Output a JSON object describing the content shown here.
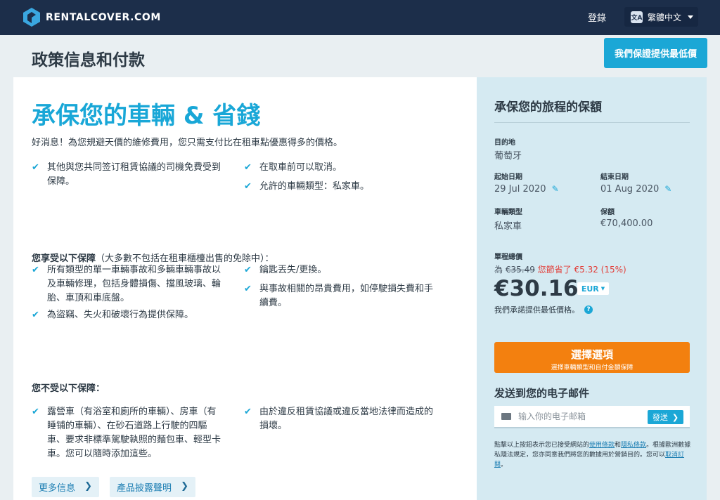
{
  "header": {
    "logo_text": "RENTALCOVER.COM",
    "login": "登錄",
    "language": "繁體中文",
    "lang_icon": "文A"
  },
  "page": {
    "title": "政策信息和付款",
    "price_button": "我們保證提供最低價"
  },
  "main": {
    "headline": "承保您的車輛 & 省錢",
    "intro": "好消息！為您規避天價的維修費用，您只需支付比在租車點優惠得多的價格。",
    "checks_top": [
      {
        "line1": "其他與您共同签订租賃協議的司機免費受到",
        "line2": "保障。"
      },
      {
        "line1": "在取車前可以取消。"
      },
      {
        "line1": "允許的車輛類型：私家車。"
      }
    ],
    "covered_bold": "您享受以下保障",
    "covered_rest": "（大多數不包括在租車櫃檯出售的免除中）：",
    "covered": [
      {
        "lines": [
          "所有類型的單一車輛事故和多輛車輛事故以",
          "及車輛修理，包括身體損傷、擋風玻璃、輪",
          "胎、車頂和車底盤。"
        ]
      },
      {
        "lines": [
          "為盜竊、失火和破壞行為提供保障。"
        ]
      },
      {
        "lines": [
          "鑰匙丟失/更換。"
        ]
      },
      {
        "lines": [
          "與事故相關的昂貴費用，如停駛損失費和手",
          "續費。"
        ]
      }
    ],
    "not_covered_title": "您不受以下保障：",
    "not_covered": [
      {
        "lines": [
          "露營車（有浴室和廁所的車輛）、房車（有",
          "睡铺的車輛）、在砂石道路上行駛的四驅",
          "車、要求非標準駕駛執照的麵包車、輕型卡",
          "車。您可以隨時添加這些。"
        ]
      },
      {
        "lines": [
          "由於違反租賃協議或違反當地法律而造成的",
          "損壞。"
        ]
      }
    ],
    "more_info": "更多信息",
    "product_disclosure": "產品披露聲明"
  },
  "sidebar": {
    "title": "承保您的旅程的保額",
    "destination_label": "目的地",
    "destination": "葡萄牙",
    "start_label": "起始日期",
    "start_date": "29 Jul 2020",
    "end_label": "結束日期",
    "end_date": "01 Aug 2020",
    "vehicle_label": "車輛類型",
    "vehicle": "私家車",
    "cover_label": "保額",
    "cover": "€70,400.00",
    "total_label": "單程總價",
    "was_prefix": "為",
    "old_price": "€35.49",
    "saving_text": "您節省了 €5.32 (15%)",
    "price": "€30.16",
    "currency": "EUR",
    "promise": "我們承諾提供最低價格。",
    "select_main": "選擇選項",
    "select_sub": "選擇車輛類型和自付金額保障",
    "email_title": "发送到您的电子邮件",
    "email_placeholder": "输入你的电子邮箱",
    "send": "發送",
    "legal_1": "點擊以上按鈕表示您已接受網站的",
    "legal_terms": "使用條款",
    "legal_and": "和",
    "legal_privacy": "隱私條款",
    "legal_2": "。根據歐洲數據私隱法規定，您亦同意我們將您的數據用於營銷目的。您可以",
    "legal_unsub": "取消訂閱",
    "legal_end": "。"
  },
  "colors": {
    "navy": "#1c2e4a",
    "accent": "#19a7d7",
    "orange": "#f3800f",
    "sale_red": "#e2403b"
  },
  "icons": [
    "logo-icon",
    "translate-icon",
    "chevron-down-icon",
    "check-icon",
    "pencil-icon",
    "help-icon",
    "mail-icon",
    "chevron-right-icon"
  ]
}
